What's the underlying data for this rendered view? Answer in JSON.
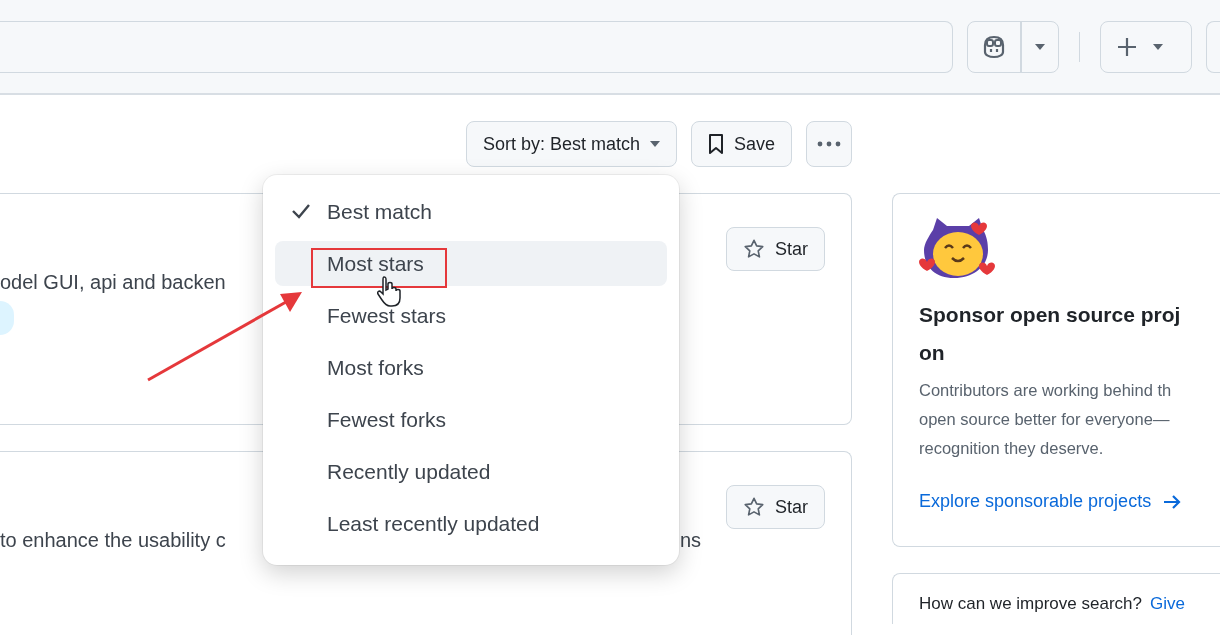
{
  "toolbar": {
    "sort_button": "Sort by: Best match",
    "save_button": "Save"
  },
  "results": [
    {
      "description": "odel GUI, api and backen",
      "star_button": "Star"
    },
    {
      "description": "to enhance the usability c",
      "description_tail": "ns",
      "star_button": "Star"
    }
  ],
  "sort_menu": {
    "items": [
      {
        "label": "Best match",
        "checked": true,
        "hovered": false
      },
      {
        "label": "Most stars",
        "checked": false,
        "hovered": true
      },
      {
        "label": "Fewest stars",
        "checked": false,
        "hovered": false
      },
      {
        "label": "Most forks",
        "checked": false,
        "hovered": false
      },
      {
        "label": "Fewest forks",
        "checked": false,
        "hovered": false
      },
      {
        "label": "Recently updated",
        "checked": false,
        "hovered": false
      },
      {
        "label": "Least recently updated",
        "checked": false,
        "hovered": false
      }
    ]
  },
  "sponsor_card": {
    "heading_lines": [
      "Sponsor open source proj",
      "on"
    ],
    "description_lines": [
      "Contributors are working behind th",
      "open source better for everyone—",
      "recognition they deserve."
    ],
    "link": "Explore sponsorable projects"
  },
  "feedback_card": {
    "question": "How can we improve search?",
    "link": "Give"
  }
}
